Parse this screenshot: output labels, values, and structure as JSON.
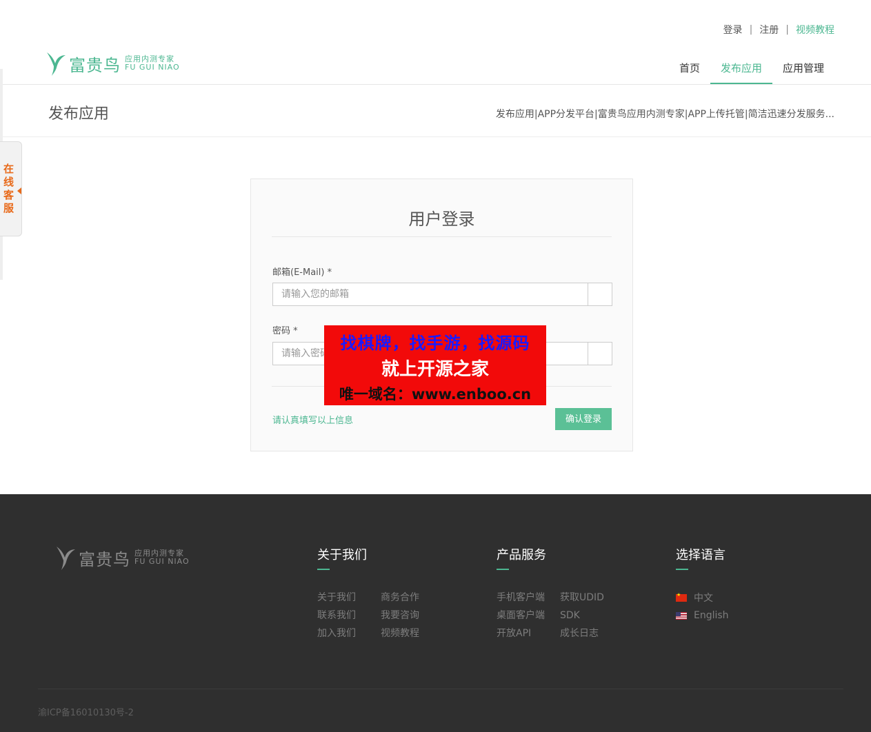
{
  "header": {
    "top_links": {
      "login": "登录",
      "register": "注册",
      "video_tutorial": "视频教程",
      "separator": "|"
    },
    "logo": {
      "name_cn": "富贵鸟",
      "tagline_cn": "应用内测专家",
      "name_en": "FU GUI NIAO"
    },
    "nav": [
      {
        "label": "首页",
        "active": false
      },
      {
        "label": "发布应用",
        "active": true
      },
      {
        "label": "应用管理",
        "active": false
      }
    ]
  },
  "titlebar": {
    "title": "发布应用",
    "description": "发布应用|APP分发平台|富贵鸟应用内测专家|APP上传托管|简洁迅速分发服务..."
  },
  "side_service": {
    "label": "在线客服"
  },
  "login": {
    "title": "用户登录",
    "email_label": "邮箱(E-Mail) *",
    "email_placeholder": "请输入您的邮箱",
    "email_value": "",
    "password_label": "密码 *",
    "password_placeholder": "请输入密码",
    "password_value": "",
    "hint": "请认真填写以上信息",
    "submit_label": "确认登录"
  },
  "watermark": {
    "line1": "找棋牌，找手游，找源码",
    "line2": "就上开源之家",
    "line3": "唯一域名：www.enboo.cn"
  },
  "footer": {
    "logo": {
      "name_cn": "富贵鸟",
      "tagline_cn": "应用内测专家",
      "name_en": "FU GUI NIAO"
    },
    "about": {
      "heading": "关于我们",
      "links": [
        "关于我们",
        "商务合作",
        "联系我们",
        "我要咨询",
        "加入我们",
        "视频教程"
      ]
    },
    "products": {
      "heading": "产品服务",
      "links": [
        "手机客户端",
        "获取UDID",
        "桌面客户端",
        "SDK",
        "开放API",
        "成长日志"
      ]
    },
    "language": {
      "heading": "选择语言",
      "options": [
        "中文",
        "English"
      ]
    },
    "icp": "渝ICP备16010130号-2"
  },
  "colors": {
    "accent": "#4cb791",
    "footer_bg": "#2f2f2f",
    "watermark_bg": "#f20a0a"
  }
}
